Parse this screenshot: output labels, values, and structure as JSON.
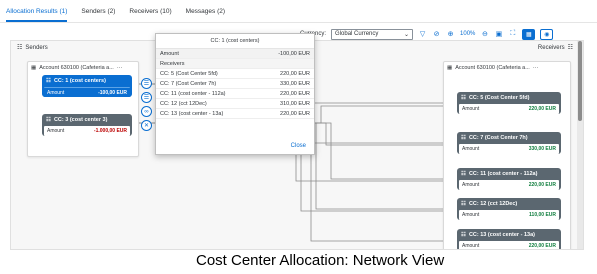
{
  "tabs": [
    {
      "label": "Allocation Results (1)",
      "active": true
    },
    {
      "label": "Senders (2)"
    },
    {
      "label": "Receivers (10)"
    },
    {
      "label": "Messages (2)"
    }
  ],
  "toolbar": {
    "currency_label": "Currency:",
    "currency_value": "Global Currency",
    "zoom": "100%"
  },
  "lanes": {
    "senders_label": "Senders",
    "receivers_label": "Receivers"
  },
  "sender_group": {
    "title": "Account 630100 (Cafeteria a...",
    "more": "···",
    "nodes": [
      {
        "title": "CC: 1 (cost centers)",
        "amount_label": "Amount",
        "amount": "-100,00 EUR"
      },
      {
        "title": "CC: 3 (cost center 3)",
        "amount_label": "Amount",
        "amount": "-1.000,00 EUR"
      }
    ]
  },
  "receiver_group": {
    "title": "Account 630100 (Cafeteria a...",
    "more": "···",
    "nodes": [
      {
        "title": "CC: 5 (Cost Center 5fd)",
        "amount_label": "Amount",
        "amount": "220,00 EUR"
      },
      {
        "title": "CC: 7 (Cost Center 7h)",
        "amount_label": "Amount",
        "amount": "330,00 EUR"
      },
      {
        "title": "CC: 11 (cost center - 112a)",
        "amount_label": "Amount",
        "amount": "220,00 EUR"
      },
      {
        "title": "CC: 12 (cct 12Dec)",
        "amount_label": "Amount",
        "amount": "110,00 EUR"
      },
      {
        "title": "CC: 13 (cost center - 13a)",
        "amount_label": "Amount",
        "amount": "220,00 EUR"
      }
    ]
  },
  "popup": {
    "title": "CC: 1 (cost centers)",
    "amount_label": "Amount",
    "amount_value": "-100,00 EUR",
    "receivers_label": "Receivers",
    "rows": [
      {
        "label": "CC: 5 (Cost Center 5fd)",
        "value": "220,00 EUR"
      },
      {
        "label": "CC: 7 (Cost Center 7h)",
        "value": "330,00 EUR"
      },
      {
        "label": "CC: 11 (cost center - 112a)",
        "value": "220,00 EUR"
      },
      {
        "label": "CC: 12 (cct 12Dec)",
        "value": "310,00 EUR"
      },
      {
        "label": "CC: 13 (cost center - 13a)",
        "value": "220,00 EUR"
      }
    ],
    "close_label": "Close"
  },
  "caption": "Cost Center Allocation: Network View",
  "colors": {
    "accent": "#0a6ed1",
    "node_grey": "#5b6770",
    "negative": "#bb0000",
    "positive": "#107e3e"
  }
}
